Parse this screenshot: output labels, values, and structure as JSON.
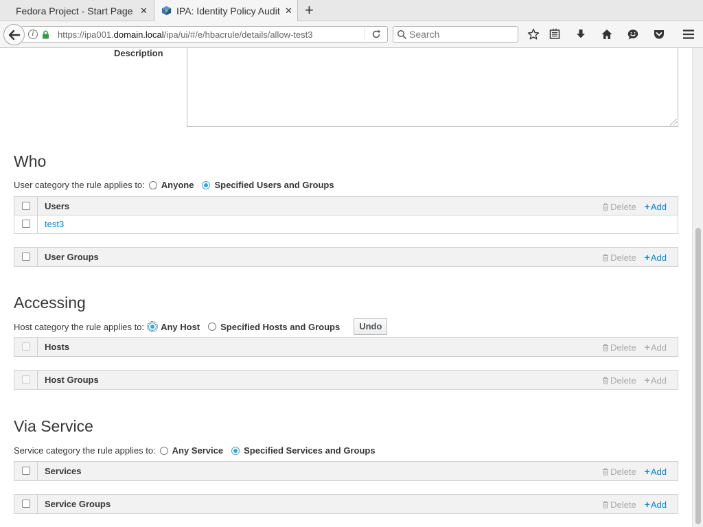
{
  "browser": {
    "tabs": [
      {
        "title": "Fedora Project - Start Page"
      },
      {
        "title": "IPA: Identity Policy Audit"
      }
    ],
    "url_prefix": "https://ipa001.",
    "url_host": "domain.local",
    "url_path": "/ipa/ui/#/e/hbacrule/details/allow-test3",
    "search_placeholder": "Search"
  },
  "page": {
    "description_label": "Description",
    "who": {
      "title": "Who",
      "category_label": "User category the rule applies to:",
      "options": [
        "Anyone",
        "Specified Users and Groups"
      ],
      "selected": "Specified Users and Groups",
      "tables": [
        {
          "title": "Users",
          "rows": [
            "test3"
          ],
          "enabled": true
        },
        {
          "title": "User Groups",
          "rows": [],
          "enabled": true
        }
      ]
    },
    "accessing": {
      "title": "Accessing",
      "category_label": "Host category the rule applies to:",
      "options": [
        "Any Host",
        "Specified Hosts and Groups"
      ],
      "selected": "Any Host",
      "undo_label": "Undo",
      "tables": [
        {
          "title": "Hosts",
          "rows": [],
          "enabled": false
        },
        {
          "title": "Host Groups",
          "rows": [],
          "enabled": false
        }
      ]
    },
    "via_service": {
      "title": "Via Service",
      "category_label": "Service category the rule applies to:",
      "options": [
        "Any Service",
        "Specified Services and Groups"
      ],
      "selected": "Specified Services and Groups",
      "tables": [
        {
          "title": "Services",
          "rows": [],
          "enabled": true
        },
        {
          "title": "Service Groups",
          "rows": [],
          "enabled": true
        }
      ]
    },
    "delete_label": "Delete",
    "add_label": "Add"
  },
  "colors": {
    "link": "#0088ce",
    "radio_checked": "#39a5dc",
    "disabled": "#a9a9a9"
  }
}
